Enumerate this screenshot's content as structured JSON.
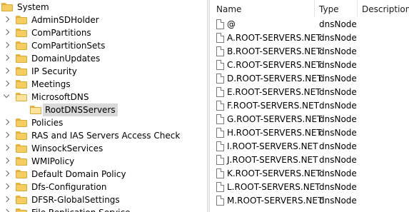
{
  "tree": {
    "root_label": "System",
    "items": [
      {
        "label": "AdminSDHolder",
        "state": "collapsed"
      },
      {
        "label": "ComPartitions",
        "state": "collapsed"
      },
      {
        "label": "ComPartitionSets",
        "state": "collapsed"
      },
      {
        "label": "DomainUpdates",
        "state": "collapsed"
      },
      {
        "label": "IP Security",
        "state": "collapsed"
      },
      {
        "label": "Meetings",
        "state": "collapsed"
      },
      {
        "label": "MicrosoftDNS",
        "state": "expanded"
      },
      {
        "label": "RootDNSServers",
        "state": "selected-child"
      },
      {
        "label": "Policies",
        "state": "collapsed"
      },
      {
        "label": "RAS and IAS Servers Access Check",
        "state": "collapsed"
      },
      {
        "label": "WinsockServices",
        "state": "collapsed"
      },
      {
        "label": "WMIPolicy",
        "state": "collapsed"
      },
      {
        "label": "Default Domain Policy",
        "state": "collapsed"
      },
      {
        "label": "Dfs-Configuration",
        "state": "collapsed"
      },
      {
        "label": "DFSR-GlobalSettings",
        "state": "collapsed"
      },
      {
        "label": "File Replication Service",
        "state": "collapsed"
      }
    ]
  },
  "list": {
    "columns": {
      "name": "Name",
      "type": "Type",
      "description": "Description"
    },
    "rows": [
      {
        "name": "@",
        "type": "dnsNode"
      },
      {
        "name": "A.ROOT-SERVERS.NET",
        "type": "dnsNode"
      },
      {
        "name": "B.ROOT-SERVERS.NET",
        "type": "dnsNode"
      },
      {
        "name": "C.ROOT-SERVERS.NET",
        "type": "dnsNode"
      },
      {
        "name": "D.ROOT-SERVERS.NET",
        "type": "dnsNode"
      },
      {
        "name": "E.ROOT-SERVERS.NET",
        "type": "dnsNode"
      },
      {
        "name": "F.ROOT-SERVERS.NET",
        "type": "dnsNode"
      },
      {
        "name": "G.ROOT-SERVERS.NET",
        "type": "dnsNode"
      },
      {
        "name": "H.ROOT-SERVERS.NET",
        "type": "dnsNode"
      },
      {
        "name": "I.ROOT-SERVERS.NET",
        "type": "dnsNode"
      },
      {
        "name": "J.ROOT-SERVERS.NET",
        "type": "dnsNode"
      },
      {
        "name": "K.ROOT-SERVERS.NET",
        "type": "dnsNode"
      },
      {
        "name": "L.ROOT-SERVERS.NET",
        "type": "dnsNode"
      },
      {
        "name": "M.ROOT-SERVERS.NET",
        "type": "dnsNode"
      }
    ]
  },
  "icons": {
    "tree_item": "folder-icon",
    "list_item": "document-icon"
  }
}
